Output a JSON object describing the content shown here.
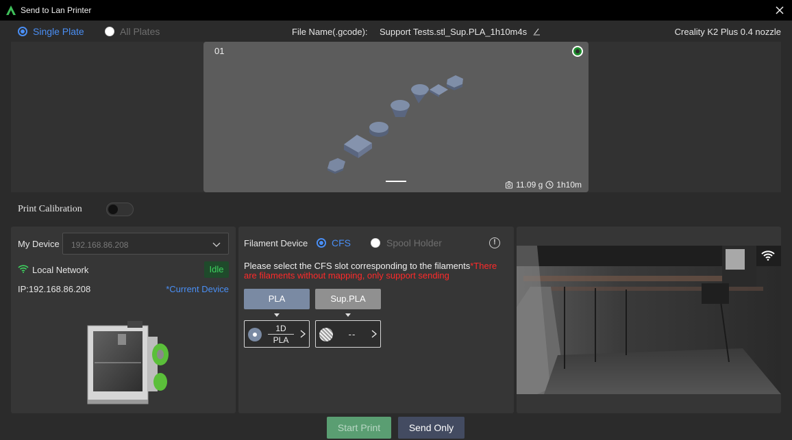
{
  "window": {
    "title": "Send to Lan Printer",
    "logo_icon": "creality-logo-icon",
    "close_icon": "close-icon"
  },
  "plate_selection": {
    "single_plate_label": "Single Plate",
    "all_plates_label": "All Plates",
    "selected": "Single Plate"
  },
  "file": {
    "label": "File Name(.gcode):",
    "name": "Support Tests.stl_Sup.PLA_1h10m4s"
  },
  "printer_profile": "Creality K2 Plus 0.4 nozzle",
  "preview": {
    "plate_number": "01",
    "weight": "11.09 g",
    "time": "1h10m"
  },
  "calibration": {
    "label": "Print Calibration",
    "enabled": false
  },
  "device": {
    "label": "My Device",
    "selected_ip": "192.168.86.208",
    "network_label": "Local Network",
    "status": "Idle",
    "ip_text": "IP:192.168.86.208",
    "current_device_label": "*Current Device"
  },
  "filament": {
    "label": "Filament Device",
    "cfs_label": "CFS",
    "spool_label": "Spool Holder",
    "selected": "CFS",
    "message": "Please select the CFS slot corresponding to the filaments",
    "warning": "*There are filaments without mapping, only support sending",
    "mappings": [
      {
        "filament": "PLA",
        "slot_id": "1D",
        "slot_type": "PLA",
        "color": "#7a8aa3"
      },
      {
        "filament": "Sup.PLA",
        "slot_id": "",
        "slot_type": "--",
        "color": "#909090"
      }
    ]
  },
  "colors": {
    "accent": "#4a8ff5",
    "idle_green": "#3ed35f",
    "warning_red": "#ff2a2a",
    "start_button": "#5a9e72",
    "send_button": "#434b61"
  },
  "actions": {
    "start_print": "Start Print",
    "send_only": "Send Only"
  }
}
